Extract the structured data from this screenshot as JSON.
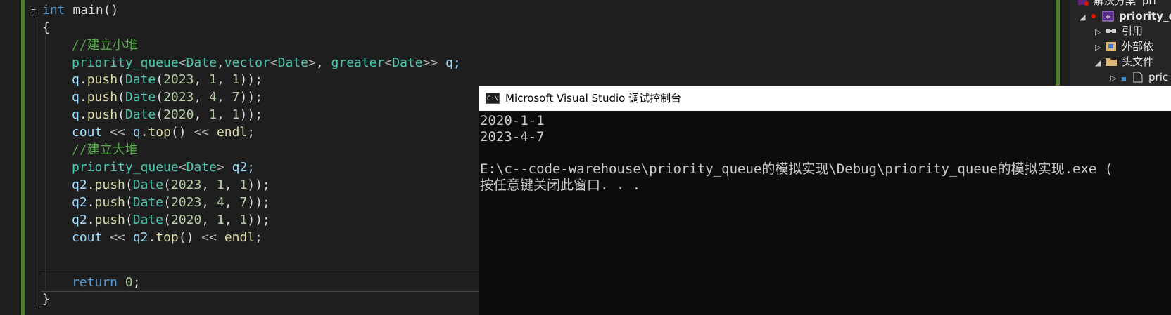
{
  "editor": {
    "lines": [
      [
        {
          "t": "int",
          "c": "kw"
        },
        {
          "t": " main()",
          "c": "pl"
        }
      ],
      [
        {
          "t": "{",
          "c": "pl"
        }
      ],
      [
        {
          "t": "//建立小堆",
          "c": "cm"
        }
      ],
      [
        {
          "t": "priority_queue",
          "c": "ty"
        },
        {
          "t": "<",
          "c": "op"
        },
        {
          "t": "Date",
          "c": "ty"
        },
        {
          "t": ",",
          "c": "pl"
        },
        {
          "t": "vector",
          "c": "ty"
        },
        {
          "t": "<",
          "c": "op"
        },
        {
          "t": "Date",
          "c": "ty"
        },
        {
          "t": ">",
          "c": "op"
        },
        {
          "t": ", ",
          "c": "pl"
        },
        {
          "t": "greater",
          "c": "ty"
        },
        {
          "t": "<",
          "c": "op"
        },
        {
          "t": "Date",
          "c": "ty"
        },
        {
          "t": ">>",
          "c": "op"
        },
        {
          "t": " q;",
          "c": "vr"
        }
      ],
      [
        {
          "t": "q",
          "c": "vr"
        },
        {
          "t": ".",
          "c": "pl"
        },
        {
          "t": "push",
          "c": "fn"
        },
        {
          "t": "(",
          "c": "pl"
        },
        {
          "t": "Date",
          "c": "ty"
        },
        {
          "t": "(",
          "c": "pl"
        },
        {
          "t": "2023",
          "c": "nm"
        },
        {
          "t": ", ",
          "c": "pl"
        },
        {
          "t": "1",
          "c": "nm"
        },
        {
          "t": ", ",
          "c": "pl"
        },
        {
          "t": "1",
          "c": "nm"
        },
        {
          "t": "));",
          "c": "pl"
        }
      ],
      [
        {
          "t": "q",
          "c": "vr"
        },
        {
          "t": ".",
          "c": "pl"
        },
        {
          "t": "push",
          "c": "fn"
        },
        {
          "t": "(",
          "c": "pl"
        },
        {
          "t": "Date",
          "c": "ty"
        },
        {
          "t": "(",
          "c": "pl"
        },
        {
          "t": "2023",
          "c": "nm"
        },
        {
          "t": ", ",
          "c": "pl"
        },
        {
          "t": "4",
          "c": "nm"
        },
        {
          "t": ", ",
          "c": "pl"
        },
        {
          "t": "7",
          "c": "nm"
        },
        {
          "t": "));",
          "c": "pl"
        }
      ],
      [
        {
          "t": "q",
          "c": "vr"
        },
        {
          "t": ".",
          "c": "pl"
        },
        {
          "t": "push",
          "c": "fn"
        },
        {
          "t": "(",
          "c": "pl"
        },
        {
          "t": "Date",
          "c": "ty"
        },
        {
          "t": "(",
          "c": "pl"
        },
        {
          "t": "2020",
          "c": "nm"
        },
        {
          "t": ", ",
          "c": "pl"
        },
        {
          "t": "1",
          "c": "nm"
        },
        {
          "t": ", ",
          "c": "pl"
        },
        {
          "t": "1",
          "c": "nm"
        },
        {
          "t": "));",
          "c": "pl"
        }
      ],
      [
        {
          "t": "cout",
          "c": "vr"
        },
        {
          "t": " << ",
          "c": "op"
        },
        {
          "t": "q",
          "c": "vr"
        },
        {
          "t": ".",
          "c": "pl"
        },
        {
          "t": "top",
          "c": "fn"
        },
        {
          "t": "()",
          "c": "pl"
        },
        {
          "t": " << ",
          "c": "op"
        },
        {
          "t": "endl",
          "c": "fn"
        },
        {
          "t": ";",
          "c": "pl"
        }
      ],
      [
        {
          "t": "//建立大堆",
          "c": "cm"
        }
      ],
      [
        {
          "t": "priority_queue",
          "c": "ty"
        },
        {
          "t": "<",
          "c": "op"
        },
        {
          "t": "Date",
          "c": "ty"
        },
        {
          "t": ">",
          "c": "op"
        },
        {
          "t": " q2;",
          "c": "vr"
        }
      ],
      [
        {
          "t": "q2",
          "c": "vr"
        },
        {
          "t": ".",
          "c": "pl"
        },
        {
          "t": "push",
          "c": "fn"
        },
        {
          "t": "(",
          "c": "pl"
        },
        {
          "t": "Date",
          "c": "ty"
        },
        {
          "t": "(",
          "c": "pl"
        },
        {
          "t": "2023",
          "c": "nm"
        },
        {
          "t": ", ",
          "c": "pl"
        },
        {
          "t": "1",
          "c": "nm"
        },
        {
          "t": ", ",
          "c": "pl"
        },
        {
          "t": "1",
          "c": "nm"
        },
        {
          "t": "));",
          "c": "pl"
        }
      ],
      [
        {
          "t": "q2",
          "c": "vr"
        },
        {
          "t": ".",
          "c": "pl"
        },
        {
          "t": "push",
          "c": "fn"
        },
        {
          "t": "(",
          "c": "pl"
        },
        {
          "t": "Date",
          "c": "ty"
        },
        {
          "t": "(",
          "c": "pl"
        },
        {
          "t": "2023",
          "c": "nm"
        },
        {
          "t": ", ",
          "c": "pl"
        },
        {
          "t": "4",
          "c": "nm"
        },
        {
          "t": ", ",
          "c": "pl"
        },
        {
          "t": "7",
          "c": "nm"
        },
        {
          "t": "));",
          "c": "pl"
        }
      ],
      [
        {
          "t": "q2",
          "c": "vr"
        },
        {
          "t": ".",
          "c": "pl"
        },
        {
          "t": "push",
          "c": "fn"
        },
        {
          "t": "(",
          "c": "pl"
        },
        {
          "t": "Date",
          "c": "ty"
        },
        {
          "t": "(",
          "c": "pl"
        },
        {
          "t": "2020",
          "c": "nm"
        },
        {
          "t": ", ",
          "c": "pl"
        },
        {
          "t": "1",
          "c": "nm"
        },
        {
          "t": ", ",
          "c": "pl"
        },
        {
          "t": "1",
          "c": "nm"
        },
        {
          "t": "));",
          "c": "pl"
        }
      ],
      [
        {
          "t": "cout",
          "c": "vr"
        },
        {
          "t": " << ",
          "c": "op"
        },
        {
          "t": "q2",
          "c": "vr"
        },
        {
          "t": ".",
          "c": "pl"
        },
        {
          "t": "top",
          "c": "fn"
        },
        {
          "t": "()",
          "c": "pl"
        },
        {
          "t": " << ",
          "c": "op"
        },
        {
          "t": "endl",
          "c": "fn"
        },
        {
          "t": ";",
          "c": "pl"
        }
      ],
      [],
      [
        {
          "t": "return",
          "c": "kw"
        },
        {
          "t": " ",
          "c": "pl"
        },
        {
          "t": "0",
          "c": "nm"
        },
        {
          "t": ";",
          "c": "pl"
        }
      ],
      [
        {
          "t": "}",
          "c": "pl"
        }
      ]
    ]
  },
  "solution_explorer": {
    "solution_label": "解决方案 'pri",
    "project_label": "priority_qu",
    "references_label": "引用",
    "external_deps_label": "外部依",
    "header_files_label": "头文件",
    "header_item_label": "pric"
  },
  "console": {
    "title": "Microsoft Visual Studio 调试控制台",
    "icon_text": "C:\\",
    "lines": [
      "2020-1-1",
      "2023-4-7",
      "",
      "E:\\c--code-warehouse\\priority_queue的模拟实现\\Debug\\priority_queue的模拟实现.exe (",
      "按任意键关闭此窗口. . ."
    ]
  },
  "colors": {
    "editor_bg": "#1e1e1e",
    "gutter_bar": "#4f7a2e",
    "keyword": "#569cd6",
    "comment": "#57a64a",
    "type": "#4ec9b0",
    "function": "#dcdcaa",
    "number": "#b5cea8",
    "variable": "#9cdcfe",
    "console_bg": "#0c0c0c",
    "console_text": "#cccccc"
  }
}
